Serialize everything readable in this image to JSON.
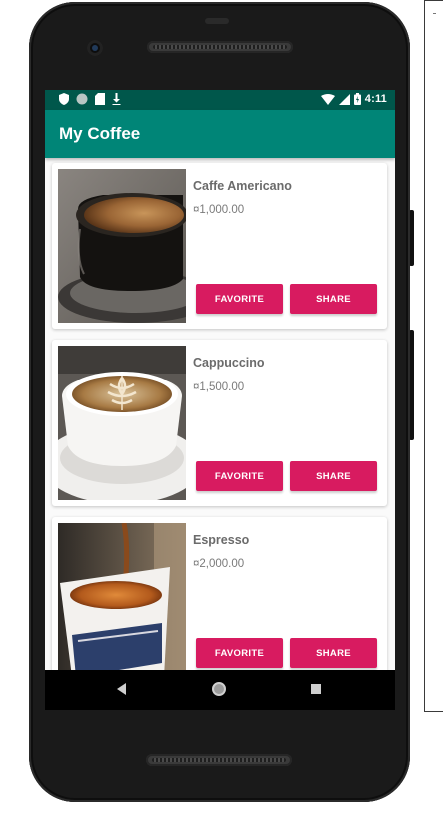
{
  "statusbar": {
    "time": "4:11",
    "left_icons": [
      "shield-icon",
      "circle-icon",
      "sd-card-icon",
      "download-icon"
    ],
    "right_icons": [
      "wifi-icon",
      "signal-icon",
      "battery-icon"
    ],
    "color": "#00574b"
  },
  "app": {
    "title": "My Coffee",
    "primary_color": "#008577",
    "accent_color": "#d81b60"
  },
  "coffees": [
    {
      "name": "Caffe Americano",
      "price": "¤1,000.00",
      "favorite_label": "FAVORITE",
      "share_label": "SHARE",
      "image": "americano-photo"
    },
    {
      "name": "Cappuccino",
      "price": "¤1,500.00",
      "favorite_label": "FAVORITE",
      "share_label": "SHARE",
      "image": "cappuccino-photo"
    },
    {
      "name": "Espresso",
      "price": "¤2,000.00",
      "favorite_label": "FAVORITE",
      "share_label": "SHARE",
      "image": "espresso-photo"
    }
  ],
  "navbar": {
    "icons": [
      "back-icon",
      "home-icon",
      "recents-icon"
    ]
  }
}
